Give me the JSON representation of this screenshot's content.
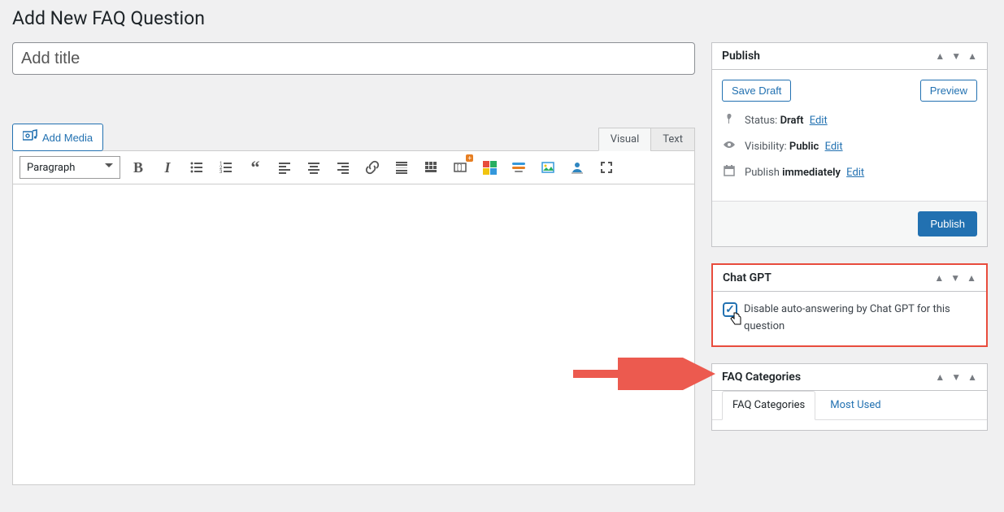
{
  "page": {
    "title": "Add New FAQ Question"
  },
  "title_input": {
    "placeholder": "Add title"
  },
  "editor": {
    "add_media_label": "Add Media",
    "tabs": {
      "visual": "Visual",
      "text": "Text"
    },
    "format_select": "Paragraph"
  },
  "publish": {
    "heading": "Publish",
    "save_draft": "Save Draft",
    "preview": "Preview",
    "status_label": "Status:",
    "status_value": "Draft",
    "visibility_label": "Visibility:",
    "visibility_value": "Public",
    "schedule_label": "Publish",
    "schedule_value": "immediately",
    "edit": "Edit",
    "publish_btn": "Publish"
  },
  "chatgpt": {
    "heading": "Chat GPT",
    "checkbox_label": "Disable auto-answering by Chat GPT for this question"
  },
  "categories": {
    "heading": "FAQ Categories",
    "tab_all": "FAQ Categories",
    "tab_most_used": "Most Used"
  }
}
